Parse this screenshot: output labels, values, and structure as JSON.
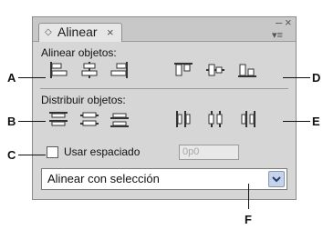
{
  "panel": {
    "tab_glyph": "◇",
    "tab_title": "Alinear",
    "tab_close": "×",
    "window_minimize": "–",
    "window_close": "×",
    "menu_glyph": "▾≡"
  },
  "align": {
    "title": "Alinear objetos:"
  },
  "distribute": {
    "title": "Distribuir objetos:"
  },
  "spacing": {
    "checkbox_label": "Usar espaciado",
    "placeholder": "0p0"
  },
  "align_to": {
    "selected": "Alinear con selección"
  },
  "callouts": {
    "a": "A",
    "b": "B",
    "c": "C",
    "d": "D",
    "e": "E",
    "f": "F"
  }
}
